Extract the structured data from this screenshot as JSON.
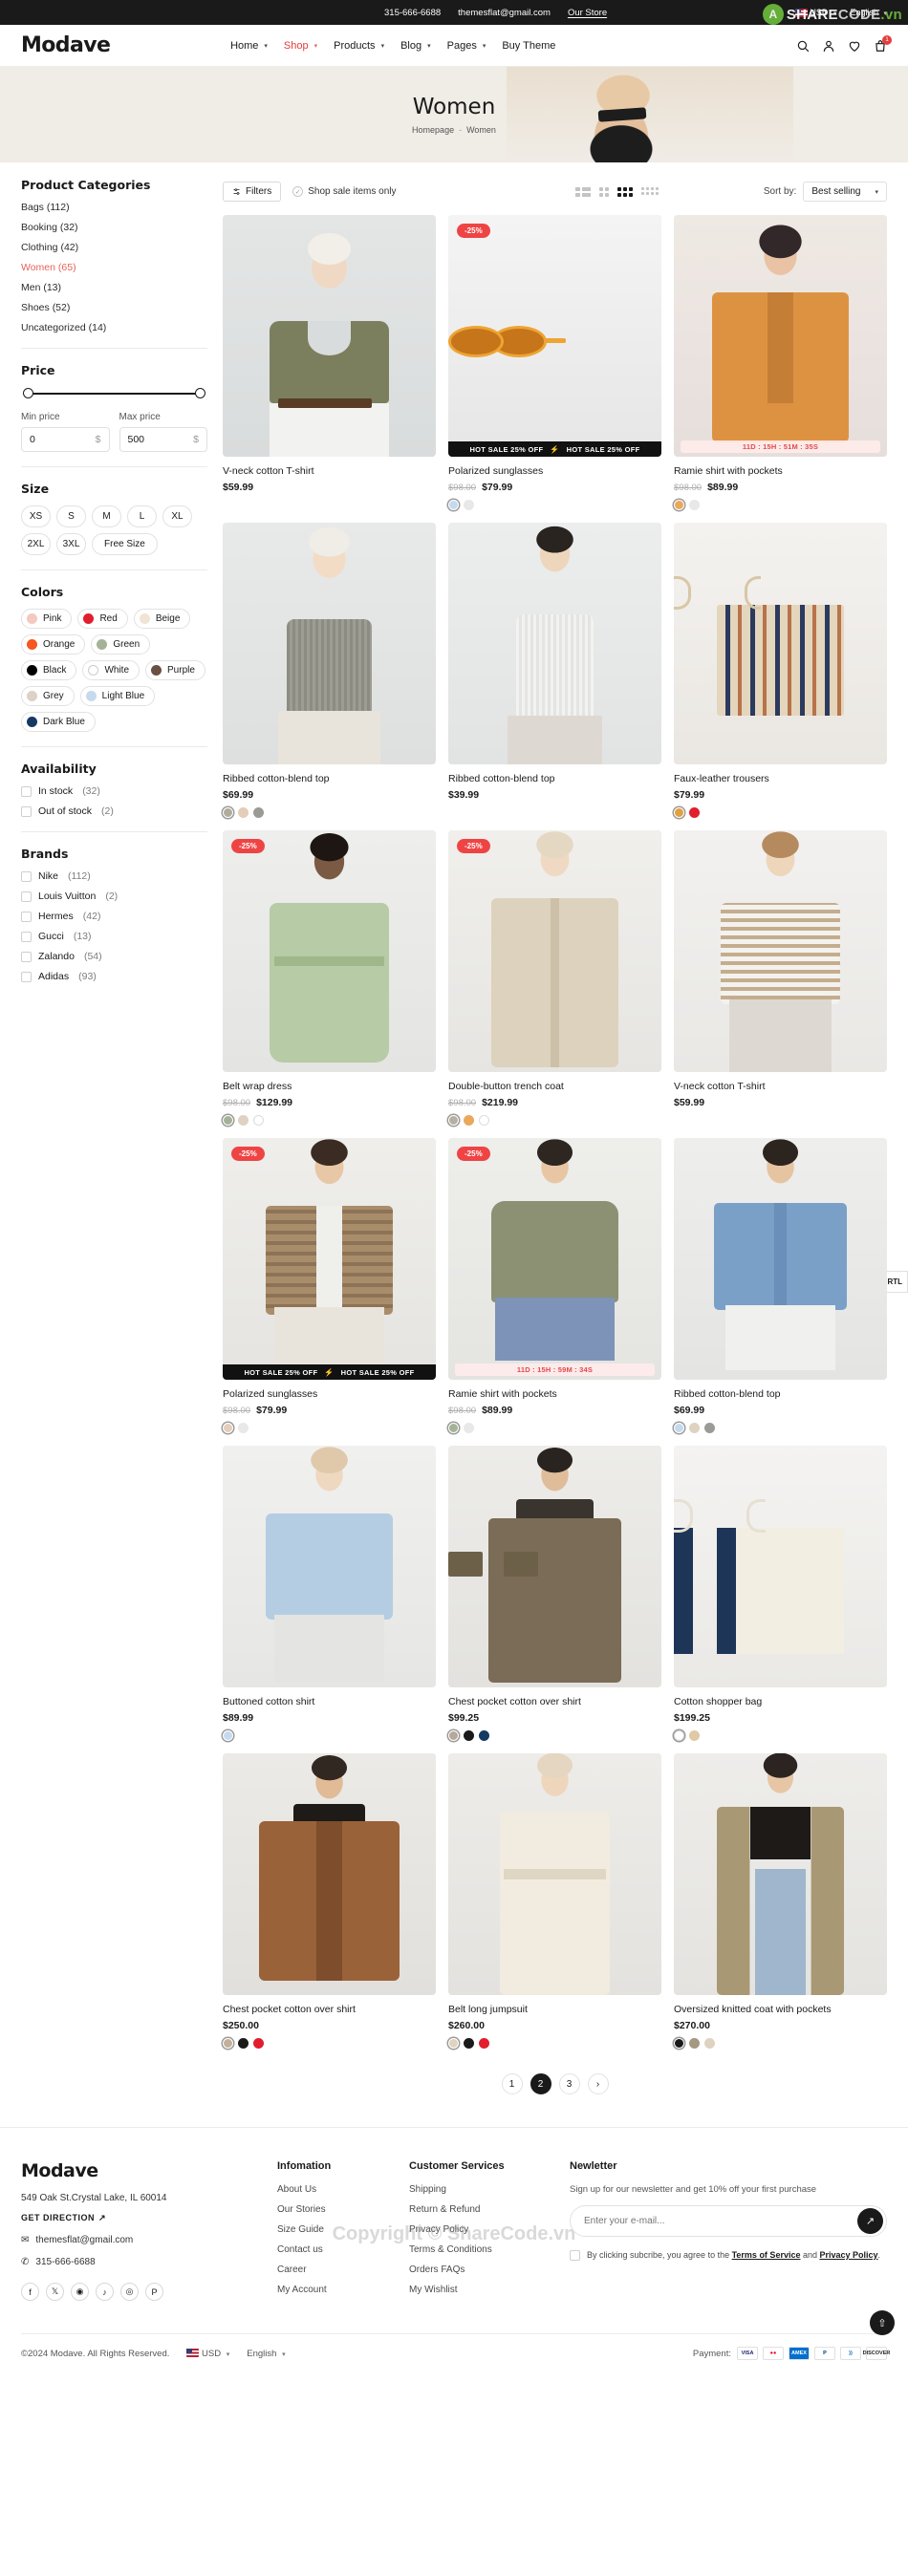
{
  "topbar": {
    "phone": "315-666-6688",
    "email": "themesflat@gmail.com",
    "store_link": "Our Store",
    "currency": "USD",
    "language": "English"
  },
  "watermark": {
    "share": "SHARE",
    "code": "CODE",
    "vn": ".vn",
    "mid": "Copyright © ShareCode.vn",
    "logo_letter": "A"
  },
  "header": {
    "logo": "Modave",
    "nav": [
      {
        "label": "Home",
        "caret": true,
        "active": false
      },
      {
        "label": "Shop",
        "caret": true,
        "active": true
      },
      {
        "label": "Products",
        "caret": true,
        "active": false
      },
      {
        "label": "Blog",
        "caret": true,
        "active": false
      },
      {
        "label": "Pages",
        "caret": true,
        "active": false
      },
      {
        "label": "Buy Theme",
        "caret": false,
        "active": false
      }
    ],
    "cart_count": "1"
  },
  "hero": {
    "title": "Women",
    "breadcrumb_home": "Homepage",
    "breadcrumb_sep": "-",
    "breadcrumb_current": "Women"
  },
  "toolbar": {
    "filters_label": "Filters",
    "sale_only_label": "Shop sale items only",
    "sort_label": "Sort by:",
    "sort_value": "Best selling"
  },
  "sidebar": {
    "categories_title": "Product Categories",
    "categories": [
      {
        "label": "Bags (112)",
        "selected": false
      },
      {
        "label": "Booking (32)",
        "selected": false
      },
      {
        "label": "Clothing (42)",
        "selected": false
      },
      {
        "label": "Women (65)",
        "selected": true
      },
      {
        "label": "Men (13)",
        "selected": false
      },
      {
        "label": "Shoes (52)",
        "selected": false
      },
      {
        "label": "Uncategorized (14)",
        "selected": false
      }
    ],
    "price_title": "Price",
    "min_label": "Min price",
    "max_label": "Max price",
    "min_value": "0",
    "max_value": "500",
    "currency_sign": "$",
    "size_title": "Size",
    "sizes": [
      "XS",
      "S",
      "M",
      "L",
      "XL",
      "2XL",
      "3XL",
      "Free Size"
    ],
    "colors_title": "Colors",
    "colors": [
      {
        "label": "Pink",
        "hex": "#f3c9c2"
      },
      {
        "label": "Red",
        "hex": "#e01e2d"
      },
      {
        "label": "Beige",
        "hex": "#f0e4d4"
      },
      {
        "label": "Orange",
        "hex": "#f4571f"
      },
      {
        "label": "Green",
        "hex": "#a5b297"
      },
      {
        "label": "Black",
        "hex": "#000000"
      },
      {
        "label": "White",
        "hex": "#ffffff"
      },
      {
        "label": "Purple",
        "hex": "#6b4f42"
      },
      {
        "label": "Grey",
        "hex": "#ded2c4"
      },
      {
        "label": "Light Blue",
        "hex": "#c5daef"
      },
      {
        "label": "Dark Blue",
        "hex": "#143a63"
      }
    ],
    "availability_title": "Availability",
    "availability": [
      {
        "label": "In stock",
        "count": "(32)"
      },
      {
        "label": "Out of stock",
        "count": "(2)"
      }
    ],
    "brands_title": "Brands",
    "brands": [
      {
        "label": "Nike",
        "count": "(112)"
      },
      {
        "label": "Louis Vuitton",
        "count": "(2)"
      },
      {
        "label": "Hermes",
        "count": "(42)"
      },
      {
        "label": "Gucci",
        "count": "(13)"
      },
      {
        "label": "Zalando",
        "count": "(54)"
      },
      {
        "label": "Adidas",
        "count": "(93)"
      }
    ]
  },
  "products": [
    {
      "name": "V-neck cotton T-shirt",
      "price": "$59.99",
      "old_price": "",
      "badge": "",
      "hot_sale": "",
      "countdown": "",
      "swatches": [],
      "scene": "tshirt-olive"
    },
    {
      "name": "Polarized sunglasses",
      "price": "$79.99",
      "old_price": "$98.00",
      "badge": "-25%",
      "hot_sale": "HOT SALE 25% OFF",
      "countdown": "",
      "swatches": [
        "#c5daef",
        "#e8e8e8"
      ],
      "scene": "sunglasses"
    },
    {
      "name": "Ramie shirt with pockets",
      "price": "$89.99",
      "old_price": "$98.00",
      "badge": "",
      "hot_sale": "",
      "countdown": "11D : 15H : 51M : 35S",
      "swatches": [
        "#e9a85c",
        "#e8e8e8"
      ],
      "scene": "shirt-orange"
    },
    {
      "name": "Ribbed cotton-blend top",
      "price": "$69.99",
      "old_price": "",
      "badge": "",
      "hot_sale": "",
      "countdown": "",
      "swatches": [
        "#b0ab9b",
        "#e4cdb9",
        "#9a9a96"
      ],
      "scene": "ribbed-grey"
    },
    {
      "name": "Ribbed cotton-blend top",
      "price": "$39.99",
      "old_price": "",
      "badge": "",
      "hot_sale": "",
      "countdown": "",
      "swatches": [],
      "scene": "ribbed-white"
    },
    {
      "name": "Faux-leather trousers",
      "price": "$79.99",
      "old_price": "",
      "badge": "",
      "hot_sale": "",
      "countdown": "",
      "swatches": [
        "#e0a040",
        "#e01e2d"
      ],
      "scene": "bag-stripe"
    },
    {
      "name": "Belt wrap dress",
      "price": "$129.99",
      "old_price": "$98.00",
      "badge": "-25%",
      "hot_sale": "",
      "countdown": "",
      "swatches": [
        "#a5b297",
        "#e0d2c0",
        "#ffffff"
      ],
      "scene": "dress-green"
    },
    {
      "name": "Double-button trench coat",
      "price": "$219.99",
      "old_price": "$98.00",
      "badge": "-25%",
      "hot_sale": "",
      "countdown": "",
      "swatches": [
        "#b5b0a2",
        "#e9a85c",
        "#ffffff"
      ],
      "scene": "trench-beige"
    },
    {
      "name": "V-neck cotton T-shirt",
      "price": "$59.99",
      "old_price": "",
      "badge": "",
      "hot_sale": "",
      "countdown": "",
      "swatches": [],
      "scene": "stripe-top"
    },
    {
      "name": "Polarized sunglasses",
      "price": "$79.99",
      "old_price": "$98.00",
      "badge": "-25%",
      "hot_sale": "HOT SALE 25% OFF",
      "countdown": "",
      "swatches": [
        "#e4cdb9",
        "#e8e8e8"
      ],
      "scene": "plaid-shirt"
    },
    {
      "name": "Ramie shirt with pockets",
      "price": "$89.99",
      "old_price": "$98.00",
      "badge": "-25%",
      "hot_sale": "",
      "countdown": "11D : 15H : 59M : 34S",
      "swatches": [
        "#a5b297",
        "#e8e8e8"
      ],
      "scene": "hoodie-green"
    },
    {
      "name": "Ribbed cotton-blend top",
      "price": "$69.99",
      "old_price": "",
      "badge": "",
      "hot_sale": "",
      "countdown": "",
      "swatches": [
        "#c5daef",
        "#e0d2c0",
        "#9a9a96"
      ],
      "scene": "denim-jacket"
    },
    {
      "name": "Buttoned cotton shirt",
      "price": "$89.99",
      "old_price": "",
      "badge": "",
      "hot_sale": "",
      "countdown": "",
      "swatches": [
        "#c5daef"
      ],
      "scene": "blue-shirt"
    },
    {
      "name": "Chest pocket cotton over shirt",
      "price": "$99.25",
      "old_price": "",
      "badge": "",
      "hot_sale": "",
      "countdown": "",
      "swatches": [
        "#b5a99a",
        "#1a1a1a",
        "#143a63"
      ],
      "scene": "overshirt-brown"
    },
    {
      "name": "Cotton shopper bag",
      "price": "$199.25",
      "old_price": "",
      "badge": "",
      "hot_sale": "",
      "countdown": "",
      "swatches": [
        "#ffffff",
        "#e0c9a6"
      ],
      "scene": "tote-bag"
    },
    {
      "name": "Chest pocket cotton over shirt",
      "price": "$250.00",
      "old_price": "",
      "badge": "",
      "hot_sale": "",
      "countdown": "",
      "swatches": [
        "#c2b09a",
        "#1a1a1a",
        "#e01e2d"
      ],
      "scene": "suede-jacket"
    },
    {
      "name": "Belt long jumpsuit",
      "price": "$260.00",
      "old_price": "",
      "badge": "",
      "hot_sale": "",
      "countdown": "",
      "swatches": [
        "#e0d2c0",
        "#1a1a1a",
        "#e01e2d"
      ],
      "scene": "jumpsuit-cream"
    },
    {
      "name": "Oversized knitted coat with pockets",
      "price": "$270.00",
      "old_price": "",
      "badge": "",
      "hot_sale": "",
      "countdown": "",
      "swatches": [
        "#1a1a1a",
        "#a59880",
        "#e0d2c0"
      ],
      "scene": "long-coat"
    }
  ],
  "pagination": {
    "pages": [
      "1",
      "2",
      "3"
    ],
    "current": "2",
    "next_icon": "›"
  },
  "rtl_toggle": "RTL",
  "footer": {
    "logo": "Modave",
    "address": "549 Oak St.Crystal Lake, IL 60014",
    "direction": "GET DIRECTION",
    "email": "themesflat@gmail.com",
    "phone": "315-666-6688",
    "socials": [
      "f",
      "𝕏",
      "◉",
      "♪",
      "◎",
      "P"
    ],
    "col_information_title": "Infomation",
    "col_information": [
      "About Us",
      "Our Stories",
      "Size Guide",
      "Contact us",
      "Career",
      "My Account"
    ],
    "col_services_title": "Customer Services",
    "col_services": [
      "Shipping",
      "Return & Refund",
      "Privacy Policy",
      "Terms & Conditions",
      "Orders FAQs",
      "My Wishlist"
    ],
    "newsletter_title": "Newletter",
    "newsletter_sub": "Sign up for our newsletter and get 10% off your first purchase",
    "newsletter_placeholder": "Enter your e-mail...",
    "agree_pre": "By clicking subcribe, you agree to the ",
    "agree_tos": "Terms of Service",
    "agree_mid": " and ",
    "agree_pp": "Privacy Policy",
    "agree_end": ".",
    "copyright": "©2024 Modave. All Rights Reserved.",
    "currency": "USD",
    "language": "English",
    "payment_label": "Payment:",
    "payments": [
      {
        "label": "VISA",
        "bg": "#ffffff",
        "fg": "#1a1f71"
      },
      {
        "label": "●●",
        "bg": "#ffffff",
        "fg": "#eb001b"
      },
      {
        "label": "AMEX",
        "bg": "#006fcf",
        "fg": "#ffffff"
      },
      {
        "label": "P",
        "bg": "#ffffff",
        "fg": "#003087"
      },
      {
        "label": "))",
        "bg": "#ffffff",
        "fg": "#0a6bc0"
      },
      {
        "label": "DISCOVER",
        "bg": "#ffffff",
        "fg": "#231f20"
      }
    ]
  }
}
